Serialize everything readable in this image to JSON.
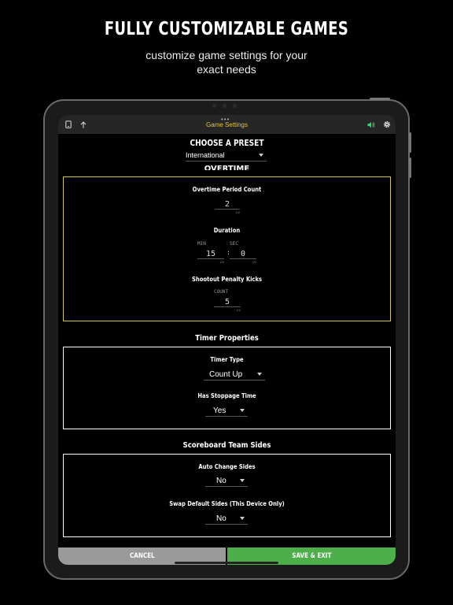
{
  "promo": {
    "headline": "FULLY CUSTOMIZABLE GAMES",
    "subline_1": "customize game settings for your",
    "subline_2": "exact needs"
  },
  "topbar": {
    "title": "Game Settings",
    "dots": "•••",
    "icons": [
      "phone-icon",
      "share-up-icon",
      "speaker-icon",
      "gear-icon"
    ],
    "speaker_color": "#3ecf6a",
    "title_color": "#e8c23a"
  },
  "preset": {
    "title": "CHOOSE A PRESET",
    "selected": "International"
  },
  "overtime": {
    "section_title": "OVERTIME",
    "period_count": {
      "label": "Overtime Period Count",
      "value": "2",
      "counter": "1/2"
    },
    "duration": {
      "label": "Duration",
      "min_label": "MIN",
      "min_value": "15",
      "min_counter": "2/3",
      "separator": ":",
      "sec_label": "SEC",
      "sec_value": "0",
      "sec_counter": "1/2"
    },
    "shootout": {
      "label": "Shootout Penalty Kicks",
      "count_label": "COUNT",
      "value": "5",
      "counter": "1/2"
    }
  },
  "timer": {
    "section_title": "Timer Properties",
    "type": {
      "label": "Timer Type",
      "selected": "Count Up"
    },
    "stoppage": {
      "label": "Has Stoppage Time",
      "selected": "Yes"
    }
  },
  "sides": {
    "section_title": "Scoreboard Team Sides",
    "auto_change": {
      "label": "Auto Change Sides",
      "selected": "No"
    },
    "swap_default": {
      "label": "Swap Default Sides (This Device Only)",
      "selected": "No"
    }
  },
  "actions": {
    "cancel": "CANCEL",
    "save": "SAVE & EXIT",
    "cancel_color": "#9a9a9a",
    "save_color": "#4caf4a"
  }
}
